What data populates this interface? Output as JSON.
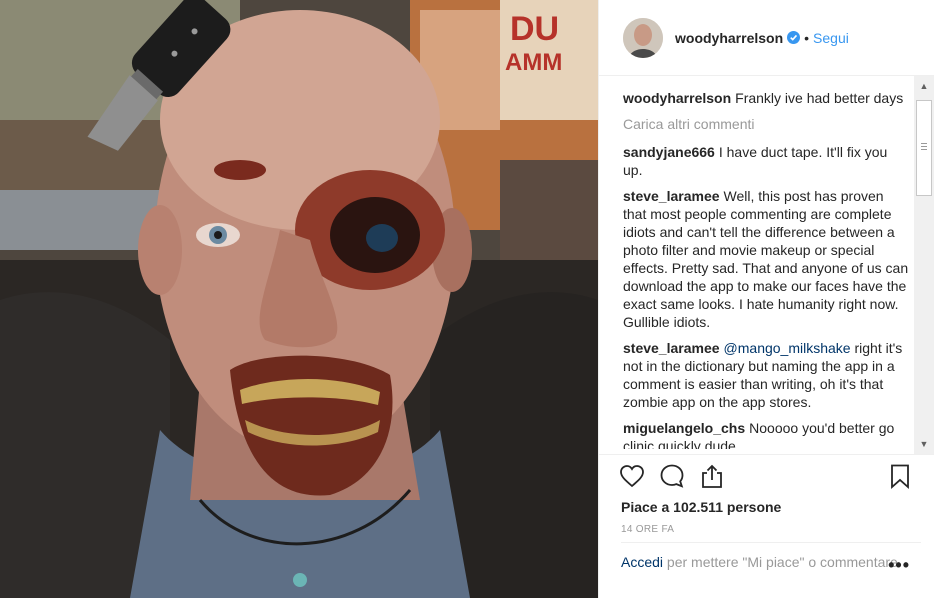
{
  "post": {
    "username": "woodyharrelson",
    "follow_label": "Segui",
    "caption_user": "woodyharrelson",
    "caption_text": "Frankly ive had better days",
    "load_more": "Carica altri commenti",
    "comments": [
      {
        "user": "sandyjane666",
        "text": "I have duct tape. It'll fix you up."
      },
      {
        "user": "steve_laramee",
        "text": "Well, this post has proven that most people commenting are complete idiots and can't tell the difference between a photo filter and movie makeup or special effects. Pretty sad. That and anyone of us can download the app to make our faces have the exact same looks. I hate humanity right now. Gullible idiots."
      },
      {
        "user": "steve_laramee",
        "mention": "@mango_milkshake",
        "text": " right it's not in the dictionary but naming the app in a comment is easier than writing, oh it's that zombie app on the app stores."
      },
      {
        "user": "miguelangelo_chs",
        "text": "Nooooo you'd better go clinic quickly dude"
      }
    ],
    "likes_label": "Piace a 102.511 persone",
    "time_label": "14 ORE FA",
    "login_label": "Accedi",
    "login_suffix": " per mettere \"Mi piace\" o commentare.",
    "more_options": "•••"
  },
  "colors": {
    "link": "#3897f0",
    "verified": "#3897f0",
    "text": "#262626",
    "muted": "#999999"
  },
  "icons": [
    "verified-badge-icon",
    "heart-icon",
    "comment-icon",
    "share-icon",
    "bookmark-icon",
    "more-options-icon"
  ]
}
